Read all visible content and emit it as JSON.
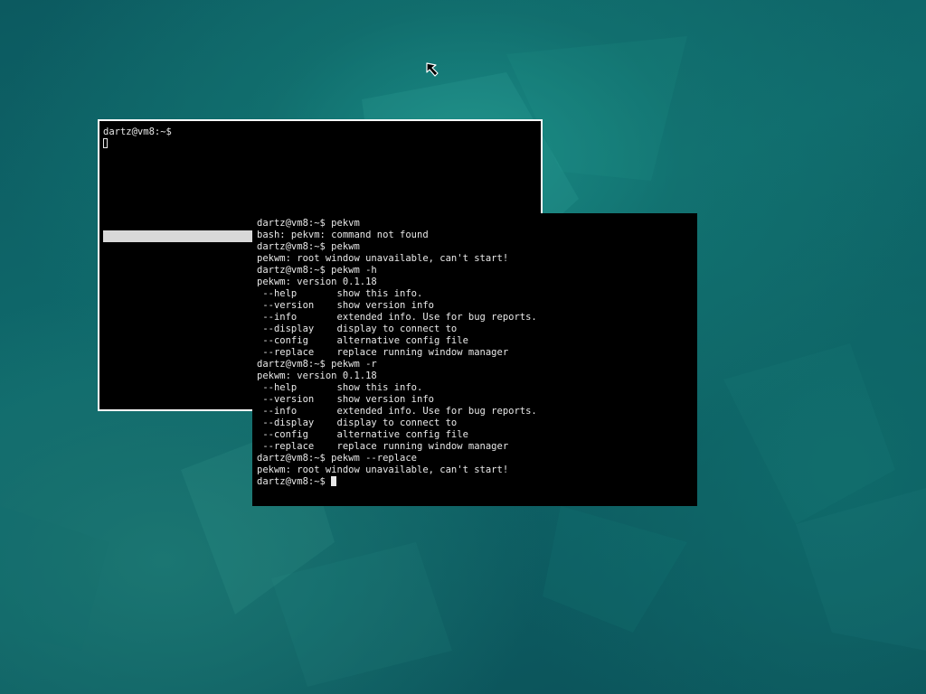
{
  "desktop": {
    "background_color": "#0d5d61",
    "accent_color": "#1a8b85"
  },
  "back_terminal": {
    "lines": [
      "dartz@vm8:~$"
    ],
    "cursor": "hollow-block"
  },
  "front_terminal": {
    "lines": [
      "dartz@vm8:~$ pekvm",
      "bash: pekvm: command not found",
      "dartz@vm8:~$ pekwm",
      "pekwm: root window unavailable, can't start!",
      "dartz@vm8:~$ pekwm -h",
      "pekwm: version 0.1.18",
      " --help       show this info.",
      " --version    show version info",
      " --info       extended info. Use for bug reports.",
      " --display    display to connect to",
      " --config     alternative config file",
      " --replace    replace running window manager",
      "dartz@vm8:~$ pekwm -r",
      "pekwm: version 0.1.18",
      " --help       show this info.",
      " --version    show version info",
      " --info       extended info. Use for bug reports.",
      " --display    display to connect to",
      " --config     alternative config file",
      " --replace    replace running window manager",
      "dartz@vm8:~$ pekwm --replace",
      "pekwm: root window unavailable, can't start!"
    ],
    "prompt": "dartz@vm8:~$ ",
    "cursor": "solid-block"
  },
  "pointer": {
    "icon": "arrow-pointer-icon"
  }
}
